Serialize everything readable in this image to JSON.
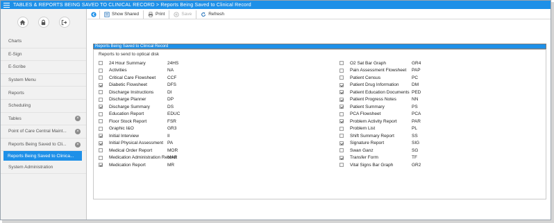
{
  "window": {
    "title": "TABLES & REPORTS BEING SAVED TO CLINICAL RECORD > Reports Being Saved to Clinical Record"
  },
  "sidebar": {
    "items": [
      {
        "label": "Charts",
        "closable": false,
        "active": false
      },
      {
        "label": "E-Sign",
        "closable": false,
        "active": false
      },
      {
        "label": "E-Scribe",
        "closable": false,
        "active": false
      },
      {
        "label": "System Menu",
        "closable": false,
        "active": false
      },
      {
        "label": "Reports",
        "closable": false,
        "active": false
      },
      {
        "label": "Scheduling",
        "closable": false,
        "active": false
      },
      {
        "label": "Tables",
        "closable": true,
        "active": false
      },
      {
        "label": "Point of Care Central Maint...",
        "closable": true,
        "active": false
      },
      {
        "label": "Reports Being Saved to Cli...",
        "closable": true,
        "active": false
      },
      {
        "label": "Reports Being Saved to Clinica...",
        "closable": false,
        "active": true
      },
      {
        "label": "System Administration",
        "closable": false,
        "active": false
      }
    ]
  },
  "toolbar": {
    "show_shared": "Show Shared",
    "print": "Print",
    "save": "Save",
    "refresh": "Refresh"
  },
  "section": {
    "header": "Reports Being Saved to Clinical Record",
    "panel_title": "Reports to send to optical disk"
  },
  "reports_left": [
    {
      "name": "24 Hour Summary",
      "code": "24HS",
      "checked": false
    },
    {
      "name": "Activities",
      "code": "NA",
      "checked": false
    },
    {
      "name": "Critical Care Flowsheet",
      "code": "CCF",
      "checked": false
    },
    {
      "name": "Diabetic Flowsheet",
      "code": "DFS",
      "checked": true
    },
    {
      "name": "Discharge Instructions",
      "code": "DI",
      "checked": false
    },
    {
      "name": "Discharge Planner",
      "code": "DP",
      "checked": false
    },
    {
      "name": "Discharge Summary",
      "code": "DS",
      "checked": true
    },
    {
      "name": "Education Report",
      "code": "EDUC",
      "checked": false
    },
    {
      "name": "Floor Stock Report",
      "code": "FSR",
      "checked": false
    },
    {
      "name": "Graphic I&O",
      "code": "GR3",
      "checked": false
    },
    {
      "name": "Initial Interview",
      "code": "II",
      "checked": true
    },
    {
      "name": "Initial Physical Assessment",
      "code": "PA",
      "checked": true
    },
    {
      "name": "Medical Order Report",
      "code": "MOR",
      "checked": false
    },
    {
      "name": "Medication Administration Record",
      "code": "MAR",
      "checked": false
    },
    {
      "name": "Medication Report",
      "code": "MR",
      "checked": true
    }
  ],
  "reports_right": [
    {
      "name": "O2 Sat Bar Graph",
      "code": "GR4",
      "checked": false
    },
    {
      "name": "Pain Assessment Flowsheet",
      "code": "PAP",
      "checked": false
    },
    {
      "name": "Patient Census",
      "code": "PC",
      "checked": false
    },
    {
      "name": "Patient Drug Information",
      "code": "DM",
      "checked": true
    },
    {
      "name": "Patient Education Documents",
      "code": "PED",
      "checked": true
    },
    {
      "name": "Patient Progress Notes",
      "code": "NN",
      "checked": true
    },
    {
      "name": "Patient Summary",
      "code": "PS",
      "checked": true
    },
    {
      "name": "PCA Flowsheet",
      "code": "PCA",
      "checked": false
    },
    {
      "name": "Problem Activity Report",
      "code": "PAR",
      "checked": true
    },
    {
      "name": "Problem List",
      "code": "PL",
      "checked": false
    },
    {
      "name": "Shift Summary Report",
      "code": "SS",
      "checked": false
    },
    {
      "name": "Signature Report",
      "code": "SIG",
      "checked": true
    },
    {
      "name": "Swan Ganz",
      "code": "SG",
      "checked": false
    },
    {
      "name": "Transfer Form",
      "code": "TF",
      "checked": true
    },
    {
      "name": "Vital Signs Bar Graph",
      "code": "GR2",
      "checked": false
    }
  ],
  "colors": {
    "accent": "#1e90e8",
    "sidebar_bg": "#f1f1f1",
    "close_badge": "#8c8c8c"
  },
  "icons": {
    "home": "home-icon",
    "lock": "lock-icon",
    "logout": "logout-icon",
    "back": "back-arrow-icon",
    "show_shared": "show-shared-icon",
    "print": "print-icon",
    "save": "save-icon",
    "refresh": "refresh-icon",
    "close": "close-icon"
  }
}
